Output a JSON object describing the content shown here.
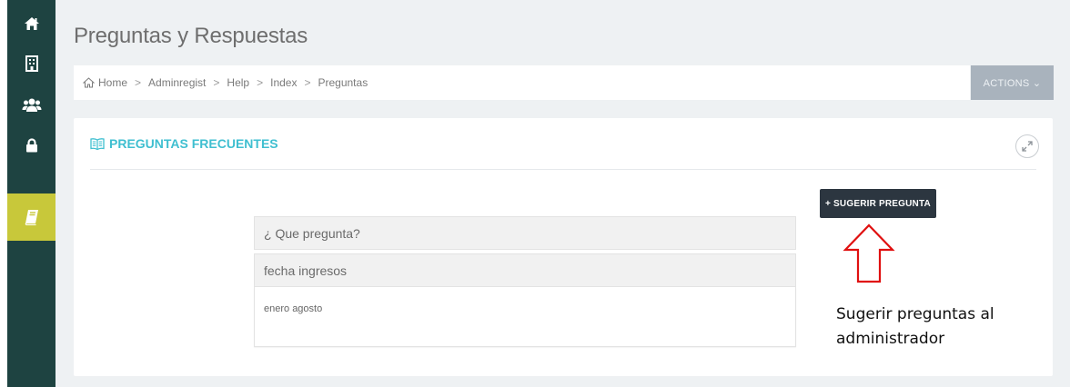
{
  "page": {
    "title": "Preguntas y Respuestas"
  },
  "breadcrumb": {
    "items": [
      "Home",
      "Adminregist",
      "Help",
      "Index",
      "Preguntas"
    ],
    "separator": ">"
  },
  "actions": {
    "label": "ACTIONS ⌄"
  },
  "panel": {
    "title": "PREGUNTAS FRECUENTES",
    "suggest_button": "+ SUGERIR PREGUNTA",
    "faq": [
      {
        "question": "¿ Que pregunta?"
      },
      {
        "question": "fecha ingresos",
        "answer": "enero agosto"
      }
    ]
  },
  "annotation": {
    "text": "Sugerir preguntas al administrador"
  },
  "sidebar": {
    "items": [
      {
        "icon": "home-icon"
      },
      {
        "icon": "building-icon"
      },
      {
        "icon": "users-icon"
      },
      {
        "icon": "lock-icon"
      },
      {
        "icon": "book-icon",
        "active": true
      }
    ]
  },
  "colors": {
    "sidebar_bg": "#1e4341",
    "sidebar_active": "#c8c83a",
    "accent": "#3fbfd0",
    "button_dark": "#2c3640",
    "arrow": "#e01010"
  }
}
